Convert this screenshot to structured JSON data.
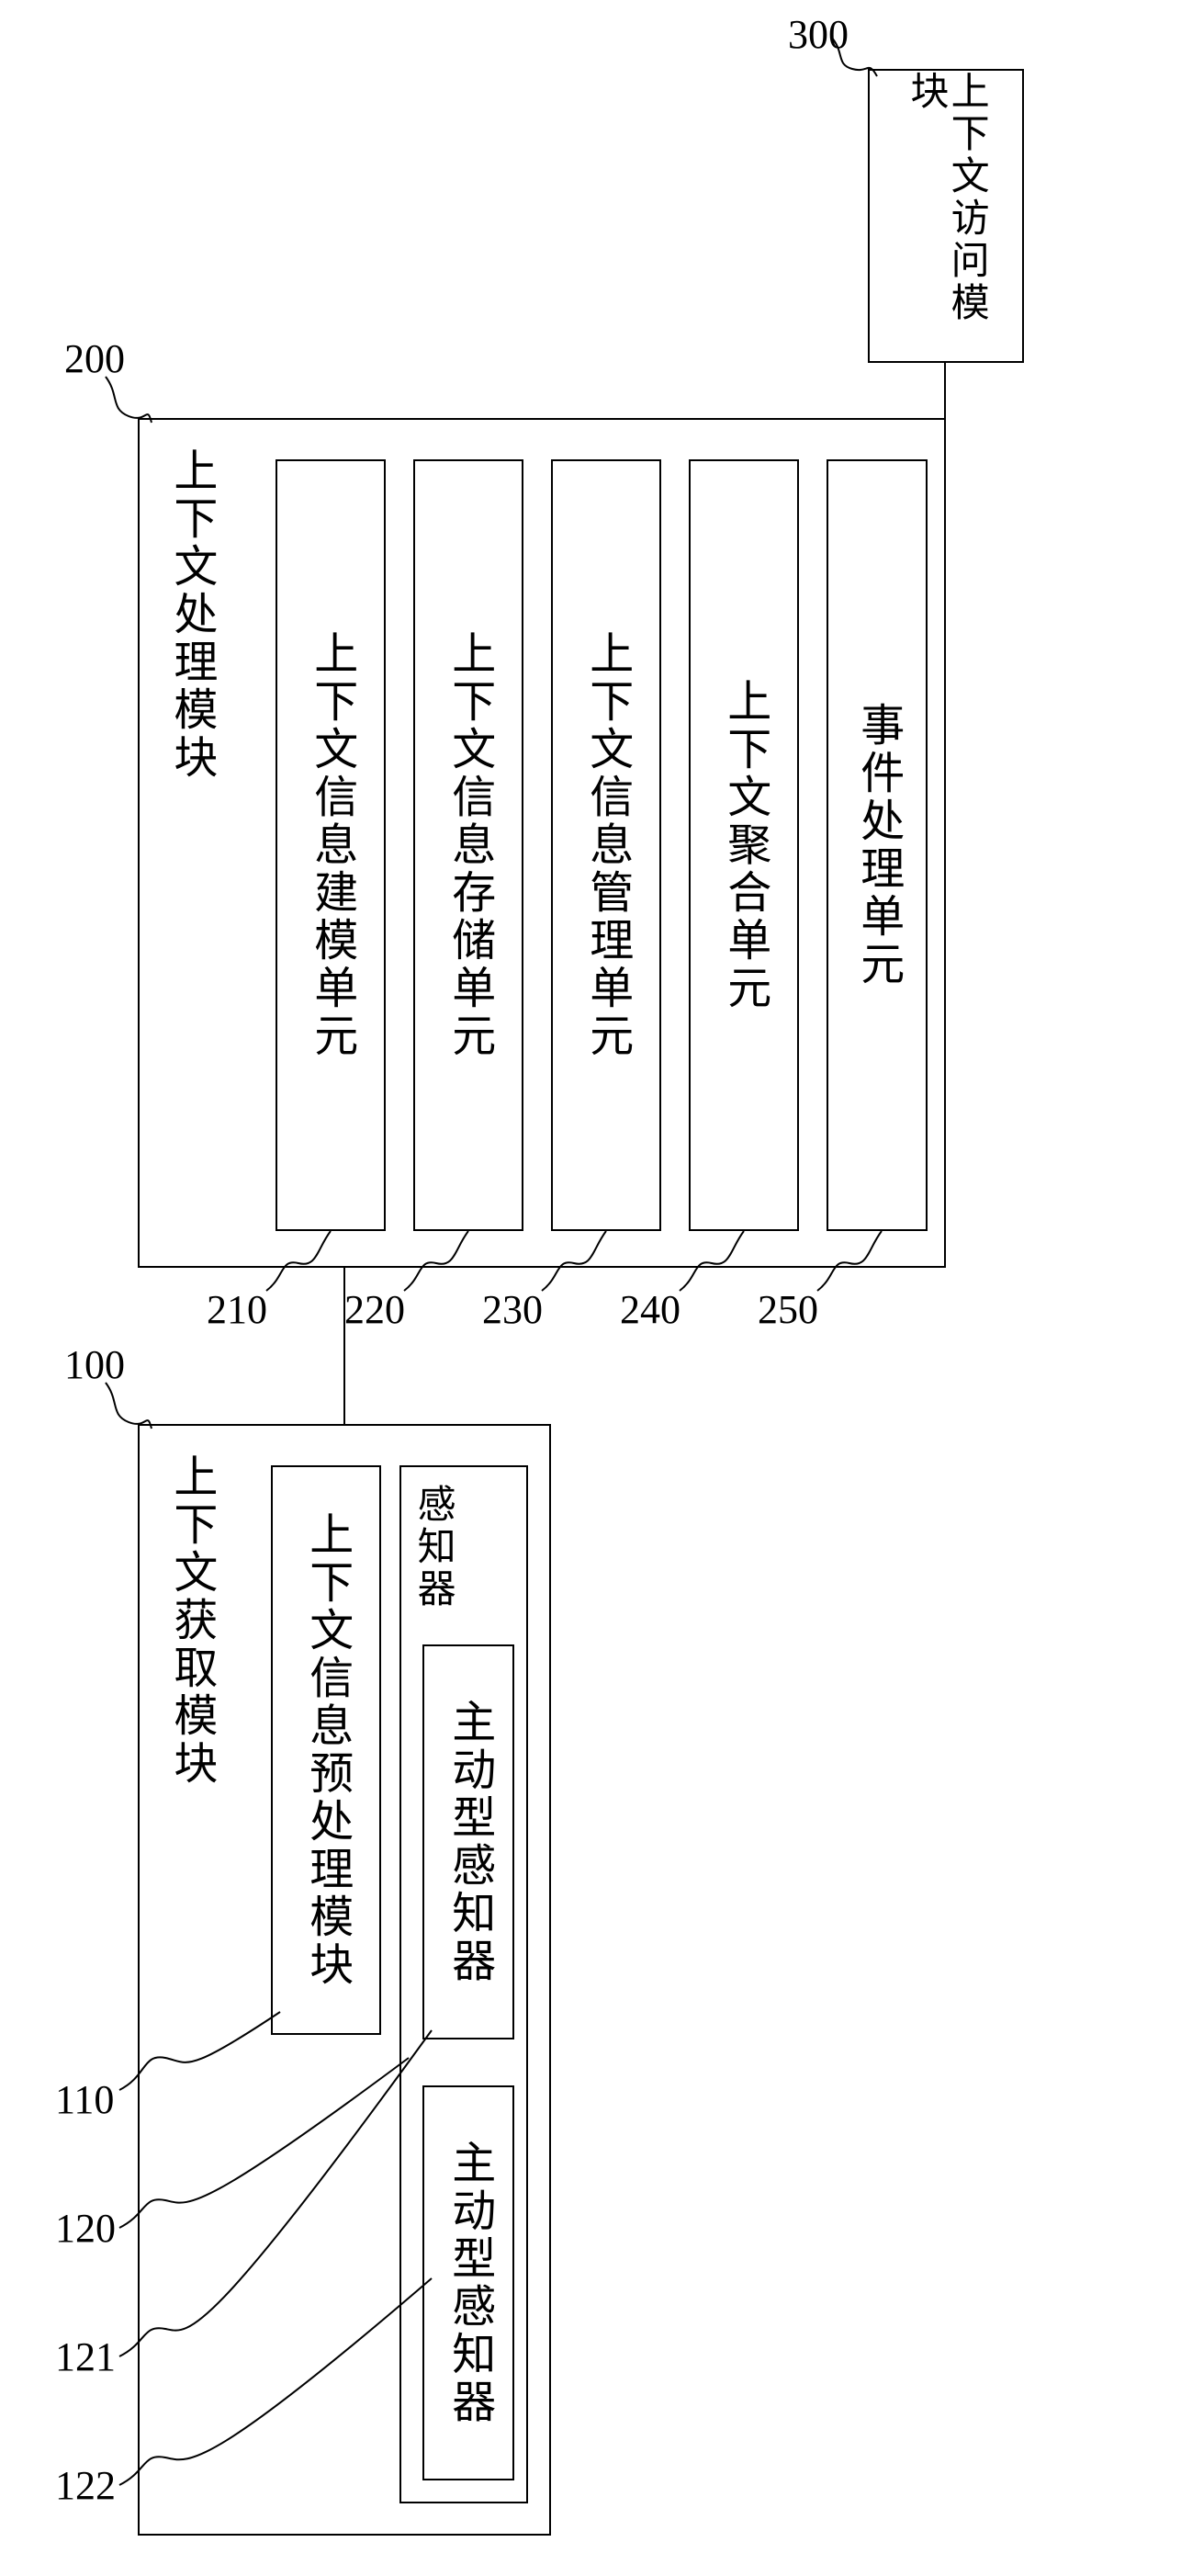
{
  "modules": {
    "acquire": {
      "ref": "100",
      "title": "上下文获取模块",
      "preprocess": {
        "ref": "110",
        "label": "上下文信息预处理模块"
      },
      "sensor_group": {
        "ref": "120",
        "label": "感知器",
        "active1": {
          "ref": "121",
          "label": "主动型感知器"
        },
        "active2": {
          "ref": "122",
          "label": "主动型感知器"
        }
      }
    },
    "process": {
      "ref": "200",
      "title": "上下文处理模块",
      "units": {
        "u210": {
          "ref": "210",
          "label": "上下文信息建模单元"
        },
        "u220": {
          "ref": "220",
          "label": "上下文信息存储单元"
        },
        "u230": {
          "ref": "230",
          "label": "上下文信息管理单元"
        },
        "u240": {
          "ref": "240",
          "label": "上下文聚合单元"
        },
        "u250": {
          "ref": "250",
          "label": "事件处理单元"
        }
      }
    },
    "access": {
      "ref": "300",
      "title": "上下文访问模块"
    }
  }
}
